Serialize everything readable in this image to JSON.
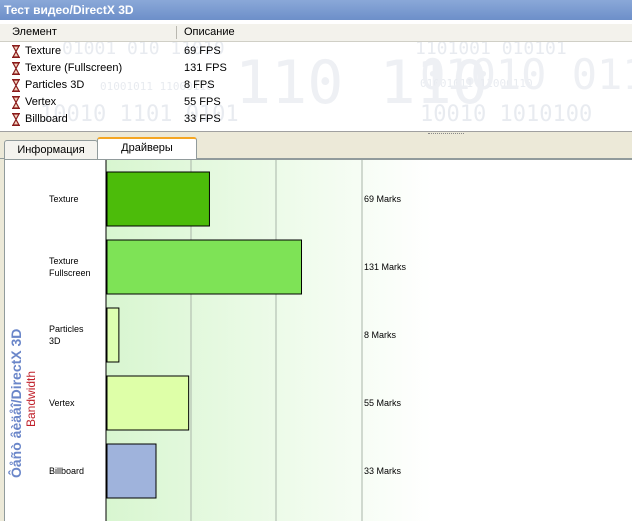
{
  "window": {
    "title": "Тест видео/DirectX 3D"
  },
  "list": {
    "columns": [
      "Элемент",
      "Описание"
    ],
    "rows": [
      {
        "name": "Texture",
        "value": "69 FPS"
      },
      {
        "name": "Texture (Fullscreen)",
        "value": "131 FPS"
      },
      {
        "name": "Particles 3D",
        "value": "8 FPS"
      },
      {
        "name": "Vertex",
        "value": "55 FPS"
      },
      {
        "name": "Billboard",
        "value": "33 FPS"
      }
    ],
    "background_digits": [
      "01001 010 11010",
      "110 110",
      "1101001 010101",
      "01001011 11000110",
      "01010 0110",
      "10010 1101 0101",
      "10010 1010100"
    ],
    "icon": "hourglass-icon"
  },
  "tabs": [
    {
      "label": "Информация",
      "active": false
    },
    {
      "label": "Драйверы",
      "active": true
    }
  ],
  "chart_data": {
    "type": "bar",
    "orientation": "horizontal",
    "ylabel": "Ôåñò âèäåî/DirectX 3D",
    "ylabel_secondary": "Bandwidth",
    "categories": [
      "Texture",
      "Texture\nFullscreen",
      "Particles\n3D",
      "Vertex",
      "Billboard"
    ],
    "values": [
      69,
      131,
      8,
      55,
      33
    ],
    "value_labels": [
      "69 Marks",
      "131 Marks",
      "8 Marks",
      "55 Marks",
      "33 Marks"
    ],
    "colors": [
      "#4cbc0a",
      "#7ee356",
      "#deffb1",
      "#deffa8",
      "#9fb3dc"
    ],
    "xlim": [
      0,
      150
    ],
    "grid": true,
    "background_gradient": [
      "#d8f6d0",
      "#ffffff"
    ]
  }
}
